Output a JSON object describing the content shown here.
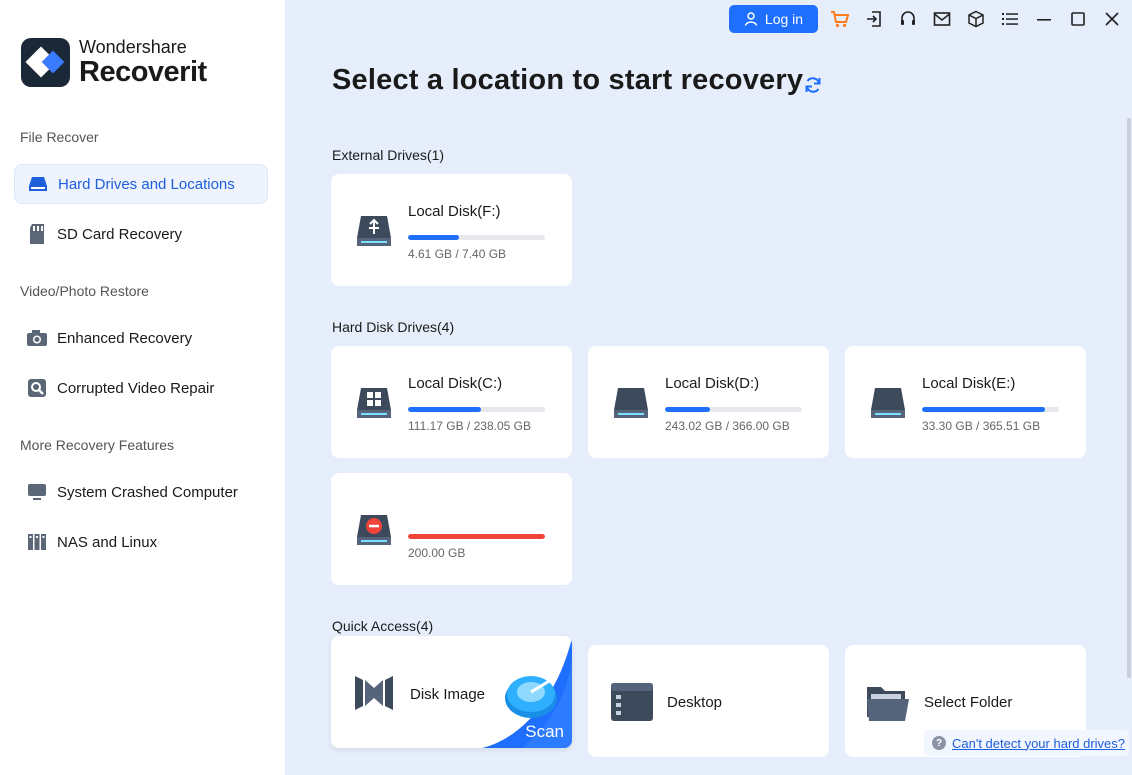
{
  "app": {
    "brand": "Wondershare",
    "product": "Recoverit"
  },
  "sidebar": {
    "sections": [
      {
        "label": "File Recover"
      },
      {
        "label": "Video/Photo Restore"
      },
      {
        "label": "More Recovery Features"
      }
    ],
    "items": [
      {
        "label": "Hard Drives and Locations",
        "icon": "hard-drive-icon",
        "active": true
      },
      {
        "label": "SD Card Recovery",
        "icon": "sd-card-icon"
      },
      {
        "label": "Enhanced Recovery",
        "icon": "camera-icon"
      },
      {
        "label": "Corrupted Video Repair",
        "icon": "video-repair-icon"
      },
      {
        "label": "System Crashed Computer",
        "icon": "monitor-icon"
      },
      {
        "label": "NAS and Linux",
        "icon": "nas-icon"
      }
    ]
  },
  "topbar": {
    "login_label": "Log in",
    "icons": [
      "cart-icon",
      "sign-in-icon",
      "headset-icon",
      "mail-icon",
      "cube-icon",
      "list-menu-icon",
      "minimize-icon",
      "maximize-icon",
      "close-icon"
    ]
  },
  "main": {
    "title": "Select a location to start recovery",
    "groups": {
      "external": "External Drives(1)",
      "hard": "Hard Disk Drives(4)",
      "quick": "Quick Access(4)"
    },
    "external_drives": [
      {
        "name": "Local Disk(F:)",
        "size": "4.61 GB / 7.40 GB",
        "fill": 0.37,
        "icon": "usb-drive-icon"
      }
    ],
    "hard_drives": [
      {
        "name": "Local Disk(C:)",
        "size": "111.17 GB / 238.05 GB",
        "fill": 0.53,
        "icon": "windows-drive-icon"
      },
      {
        "name": "Local Disk(D:)",
        "size": "243.02 GB / 366.00 GB",
        "fill": 0.33,
        "icon": "hard-drive-icon"
      },
      {
        "name": "Local Disk(E:)",
        "size": "33.30 GB / 365.51 GB",
        "fill": 0.9,
        "icon": "hard-drive-icon"
      },
      {
        "name": "",
        "size": "200.00 GB",
        "fill": 1.0,
        "icon": "error-drive-icon",
        "error": true
      }
    ],
    "quick_access": [
      {
        "label": "Disk Image",
        "icon": "disk-image-icon",
        "action": "Scan"
      },
      {
        "label": "Desktop",
        "icon": "desktop-icon"
      },
      {
        "label": "Select Folder",
        "icon": "folder-icon"
      }
    ]
  },
  "help": {
    "text": "Can't detect your hard drives?"
  },
  "colors": {
    "accent": "#1f6fff",
    "error": "#f0443a",
    "background": "#e6eefb"
  }
}
